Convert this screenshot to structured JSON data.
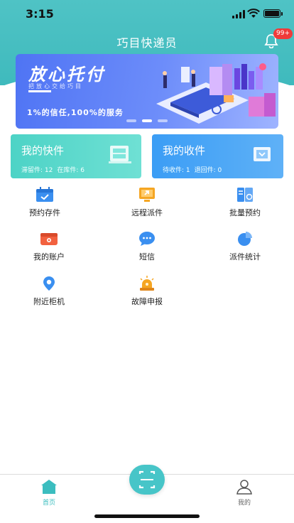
{
  "status_bar": {
    "time": "3:15"
  },
  "header": {
    "title": "巧目快递员",
    "notification_badge": "99+"
  },
  "banner": {
    "title": "放心托付",
    "subtitle": "把放心交给巧目",
    "slogan": "1%的信任,100%的服务",
    "pages": 3,
    "active_page": 2
  },
  "cards": {
    "send": {
      "title": "我的快件",
      "stats": [
        "滞留件: 12",
        "在库件: 6"
      ]
    },
    "receive": {
      "title": "我的收件",
      "stats": [
        "待收件: 1",
        "退回件: 0"
      ]
    }
  },
  "grid": [
    {
      "label": "预约存件",
      "icon": "calendar-check-icon"
    },
    {
      "label": "远程派件",
      "icon": "remote-dispatch-icon"
    },
    {
      "label": "批量预约",
      "icon": "batch-booking-icon"
    },
    {
      "label": "我的账户",
      "icon": "wallet-icon"
    },
    {
      "label": "短信",
      "icon": "sms-bubble-icon"
    },
    {
      "label": "派件统计",
      "icon": "pie-chart-icon"
    },
    {
      "label": "附近柜机",
      "icon": "locker-location-icon"
    },
    {
      "label": "故障申报",
      "icon": "alarm-light-icon"
    }
  ],
  "tabbar": {
    "home_label": "首页",
    "mine_label": "我的"
  },
  "colors": {
    "header": "#4fc3c5",
    "card_send": "#4dd3c6",
    "card_recv": "#3b9df5",
    "badge": "#f03a3a",
    "tab_active": "#3bbdbf"
  }
}
